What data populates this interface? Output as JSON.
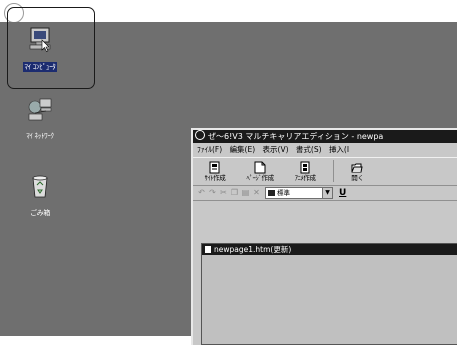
{
  "desktop": {
    "background": "#6f6f6f",
    "icons": [
      {
        "label": "ﾏｲ ｺﾝﾋﾟｭｰﾀ",
        "icon": "my-computer-icon",
        "selected": true
      },
      {
        "label": "ﾏｲ ﾈｯﾄﾜｰｸ",
        "icon": "network-icon",
        "selected": false
      },
      {
        "label": "ごみ箱",
        "icon": "recycle-bin-icon",
        "selected": false
      }
    ]
  },
  "window": {
    "title": "ぜ～6!V3 マルチキャリアエディション - newpa",
    "menu": [
      "ﾌｧｲﾙ(F)",
      "編集(E)",
      "表示(V)",
      "書式(S)",
      "挿入(I"
    ],
    "toolbar": [
      {
        "label": "ｻｲﾄ作成",
        "icon": "site-create-icon"
      },
      {
        "label": "ﾍﾟｰｼﾞ作成",
        "icon": "page-create-icon"
      },
      {
        "label": "ｱﾆﾒ作成",
        "icon": "anime-create-icon"
      },
      {
        "label": "開く",
        "icon": "open-folder-icon"
      }
    ],
    "format_bar": {
      "style_value": "標準",
      "underline_label": "U"
    },
    "document": {
      "title": "newpage1.htm(更新)"
    }
  },
  "colors": {
    "titlebar": "#1a1a1a",
    "selected_label_bg": "#1c2c70"
  }
}
